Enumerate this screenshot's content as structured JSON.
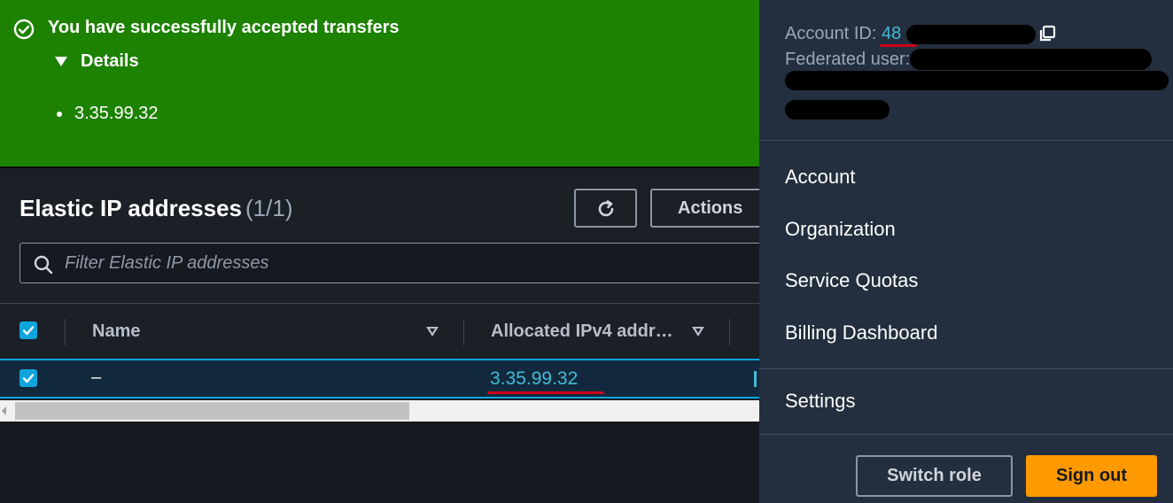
{
  "banner": {
    "message": "You have successfully accepted transfers",
    "details_label": "Details",
    "items": [
      "3.35.99.32"
    ]
  },
  "panel": {
    "title": "Elastic IP addresses",
    "count": "(1/1)",
    "actions_label": "Actions",
    "filter_placeholder": "Filter Elastic IP addresses"
  },
  "table": {
    "columns": [
      "Name",
      "Allocated IPv4 addr…"
    ],
    "rows": [
      {
        "selected": true,
        "name": "–",
        "ipv4": "3.35.99.32"
      }
    ]
  },
  "account_menu": {
    "account_id_label": "Account ID:",
    "account_id_partial": "48",
    "federated_user_label": "Federated user:",
    "items": [
      "Account",
      "Organization",
      "Service Quotas",
      "Billing Dashboard"
    ],
    "settings_label": "Settings",
    "switch_role_label": "Switch role",
    "sign_out_label": "Sign out"
  },
  "colors": {
    "success_green": "#1d8102",
    "link_blue": "#44b9d6",
    "checkbox_blue": "#0fa5dc",
    "orange_primary": "#ff9900",
    "annotation_red": "#d0021b"
  },
  "icons": [
    "check-circle-icon",
    "caret-down-icon",
    "refresh-icon",
    "search-icon",
    "checkbox-checked-icon",
    "sort-caret-icon",
    "copy-icon",
    "scroll-left-arrow-icon"
  ]
}
